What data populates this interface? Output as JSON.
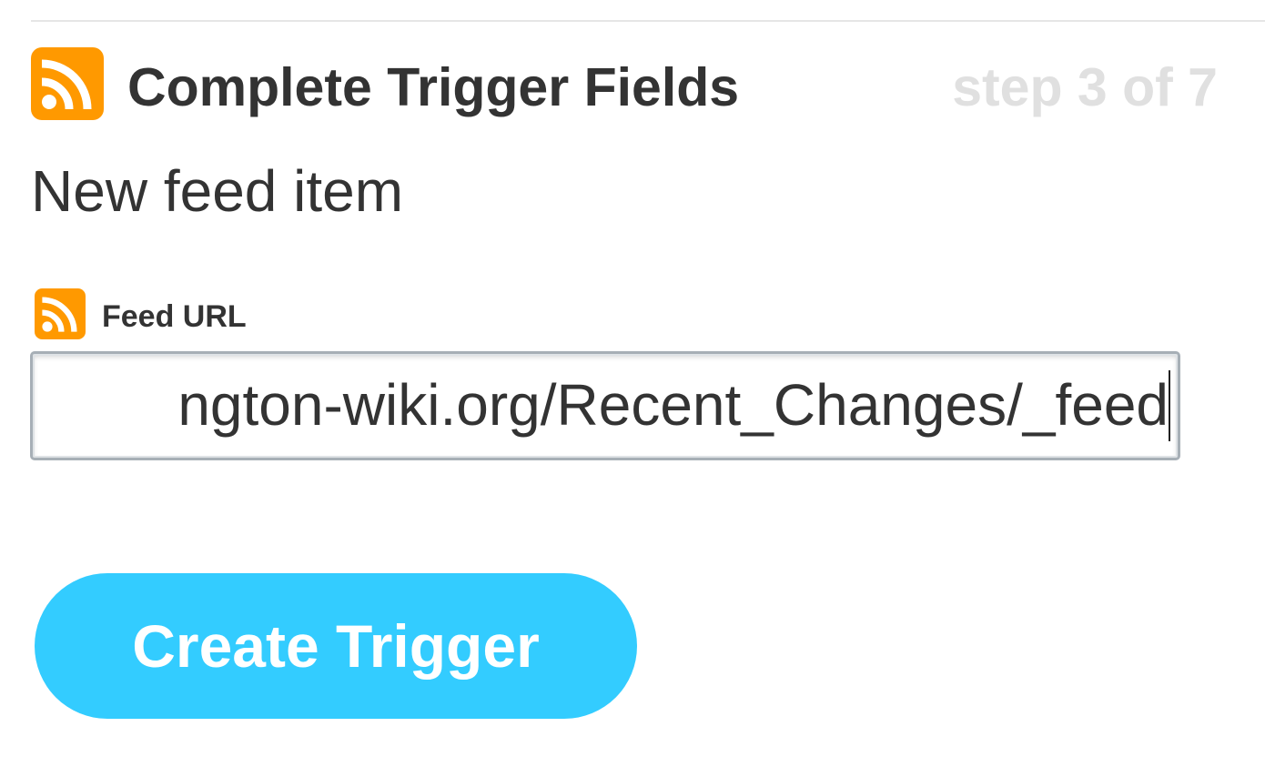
{
  "header": {
    "icon": "rss-icon",
    "title": "Complete Trigger Fields",
    "step": "step 3 of 7"
  },
  "trigger": {
    "name": "New feed item"
  },
  "field": {
    "icon": "rss-icon",
    "label": "Feed URL",
    "value": "ngton-wiki.org/Recent_Changes/_feed"
  },
  "actions": {
    "create_label": "Create Trigger"
  },
  "colors": {
    "rss_orange": "#ff9900",
    "button_blue": "#33ccff",
    "text_dark": "#333333",
    "step_gray": "#e0e0e0"
  }
}
